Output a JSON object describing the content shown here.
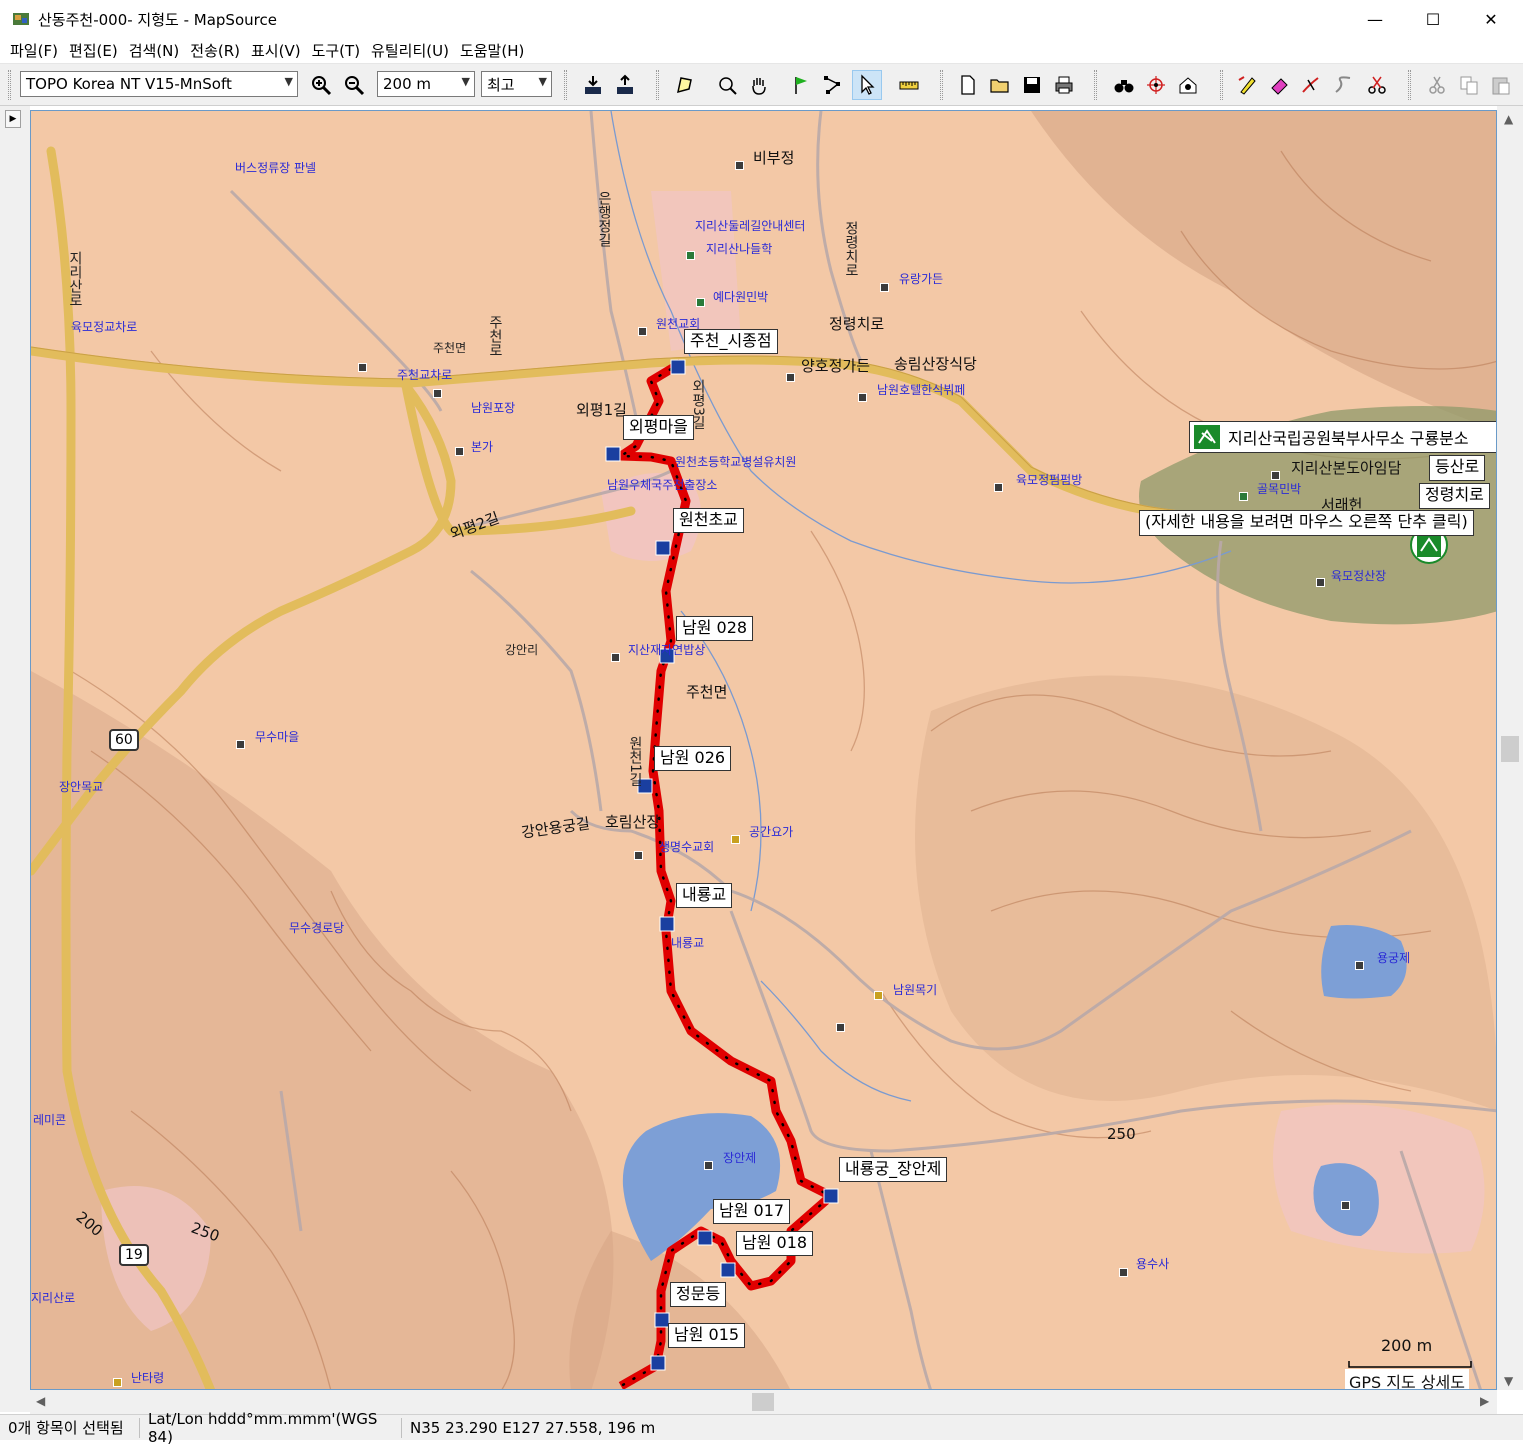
{
  "window": {
    "title": "산동주천-000- 지형도 - MapSource",
    "minimize": "—",
    "maximize": "☐",
    "close": "✕"
  },
  "menu": [
    "파일(F)",
    "편집(E)",
    "검색(N)",
    "전송(R)",
    "표시(V)",
    "도구(T)",
    "유틸리티(U)",
    "도움말(H)"
  ],
  "toolbar": {
    "map_product": "TOPO Korea NT V15-MnSoft",
    "zoom_scale": "200 m",
    "detail_level": "최고"
  },
  "map": {
    "road_labels": [
      "정령치로",
      "외평1길",
      "외평2길",
      "강안용궁길",
      "주천로",
      "은행정길",
      "외평3길",
      "정령치로",
      "원천1길",
      "지리산로"
    ],
    "place_labels": [
      "비부정",
      "양호정가든",
      "송림산장식당",
      "주천면",
      "호림산장",
      "지리산본도아임담",
      "서래헌",
      "강안리",
      "주천면",
      "본가"
    ],
    "poi_labels": [
      "버스정류장 판넬",
      "지리산둘레길안내센터",
      "지리산나들학",
      "예다원민박",
      "원천교회",
      "유랑가든",
      "육모정교차로",
      "주천교차로",
      "남원포장",
      "남원호텔한식뷔페",
      "원천초등학교병설유치원",
      "남원우체국주천출장소",
      "육모정펌펌방",
      "골목민박",
      "육모정산장",
      "지산재자연밥상",
      "무수마을",
      "장안목교",
      "공간요가",
      "생명수교회",
      "무수경로당",
      "내룡교",
      "남원목기",
      "장안제",
      "용궁제",
      "용수사",
      "레미콘",
      "난타령",
      "지리산로"
    ],
    "waypoints": [
      "주천_시종점",
      "외평마을",
      "원천초교",
      "남원 028",
      "남원 026",
      "내룡교",
      "내룡궁_장안제",
      "남원 017",
      "남원 018",
      "정문등",
      "남원 015"
    ],
    "tooltip": {
      "title": "지리산국립공원북부사무소 구룡분소",
      "items": [
        "등산로",
        "정령치로"
      ],
      "hint": "(자세한 내용을 보려면 마우스 오른쪽 단추 클릭)"
    },
    "highway_shields": [
      "60",
      "19"
    ],
    "contour_labels": [
      "250",
      "250",
      "200"
    ],
    "scale_bar": "200 m",
    "scale_caption": "GPS 지도 상세도",
    "track_color": "#e00000"
  },
  "status": {
    "selection": "0개 항목이 선택됨",
    "coord_format": "Lat/Lon hddd°mm.mmm'(WGS 84)",
    "cursor_position": "N35 23.290 E127 27.558, 196 m"
  }
}
